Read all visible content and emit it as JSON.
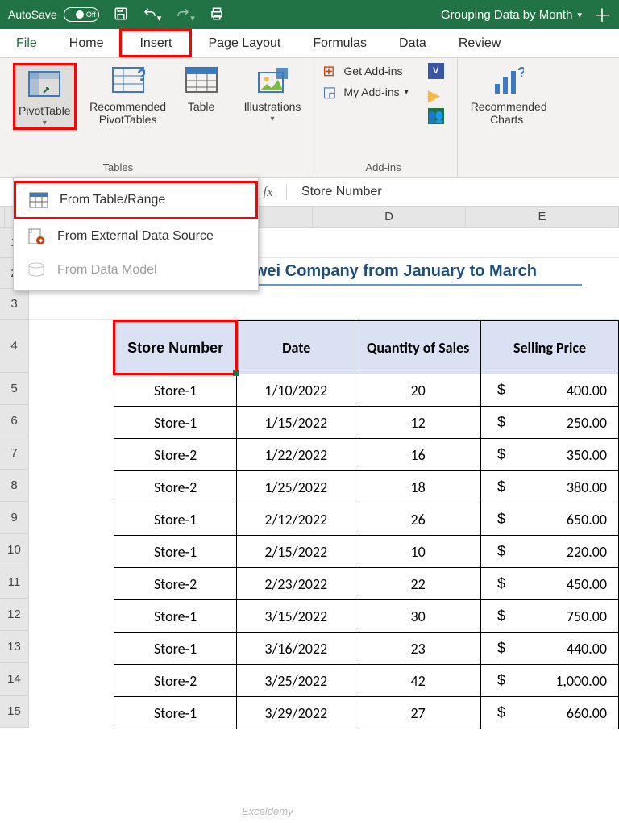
{
  "titlebar": {
    "autosave": "AutoSave",
    "toggle_state": "Off",
    "doc_name": "Grouping Data by Month"
  },
  "tabs": {
    "file": "File",
    "home": "Home",
    "insert": "Insert",
    "page_layout": "Page Layout",
    "formulas": "Formulas",
    "data": "Data",
    "review": "Review"
  },
  "ribbon": {
    "pivot_table": "PivotTable",
    "recommended_pivot": "Recommended PivotTables",
    "table": "Table",
    "tables_group": "Tables",
    "illustrations": "Illustrations",
    "get_addins": "Get Add-ins",
    "my_addins": "My Add-ins",
    "addins_group": "Add-ins",
    "recommended_charts": "Recommended Charts"
  },
  "dropdown": {
    "from_table_range": "From Table/Range",
    "from_external": "From External Data Source",
    "from_data_model": "From Data Model"
  },
  "formula_bar": {
    "fx": "fx",
    "value": "Store Number"
  },
  "col_headers": {
    "d": "D",
    "e": "E"
  },
  "row_headers": [
    "1",
    "2",
    "3",
    "4",
    "5",
    "6",
    "7",
    "8",
    "9",
    "10",
    "11",
    "12",
    "13",
    "14",
    "15"
  ],
  "sheet": {
    "title": "Sales Chart of Huawei Company from January to March",
    "headers": {
      "store": "Store Number",
      "date": "Date",
      "qty": "Quantity of Sales",
      "price": "Selling Price"
    },
    "currency": "$",
    "rows": [
      {
        "store": "Store-1",
        "date": "1/10/2022",
        "qty": "20",
        "price": "400.00"
      },
      {
        "store": "Store-1",
        "date": "1/15/2022",
        "qty": "12",
        "price": "250.00"
      },
      {
        "store": "Store-2",
        "date": "1/22/2022",
        "qty": "16",
        "price": "350.00"
      },
      {
        "store": "Store-2",
        "date": "1/25/2022",
        "qty": "18",
        "price": "380.00"
      },
      {
        "store": "Store-1",
        "date": "2/12/2022",
        "qty": "26",
        "price": "650.00"
      },
      {
        "store": "Store-1",
        "date": "2/15/2022",
        "qty": "10",
        "price": "220.00"
      },
      {
        "store": "Store-2",
        "date": "2/23/2022",
        "qty": "22",
        "price": "450.00"
      },
      {
        "store": "Store-1",
        "date": "3/15/2022",
        "qty": "30",
        "price": "750.00"
      },
      {
        "store": "Store-1",
        "date": "3/16/2022",
        "qty": "23",
        "price": "440.00"
      },
      {
        "store": "Store-2",
        "date": "3/25/2022",
        "qty": "42",
        "price": "1,000.00"
      },
      {
        "store": "Store-1",
        "date": "3/29/2022",
        "qty": "27",
        "price": "660.00"
      }
    ]
  },
  "watermark": "Exceldemy"
}
